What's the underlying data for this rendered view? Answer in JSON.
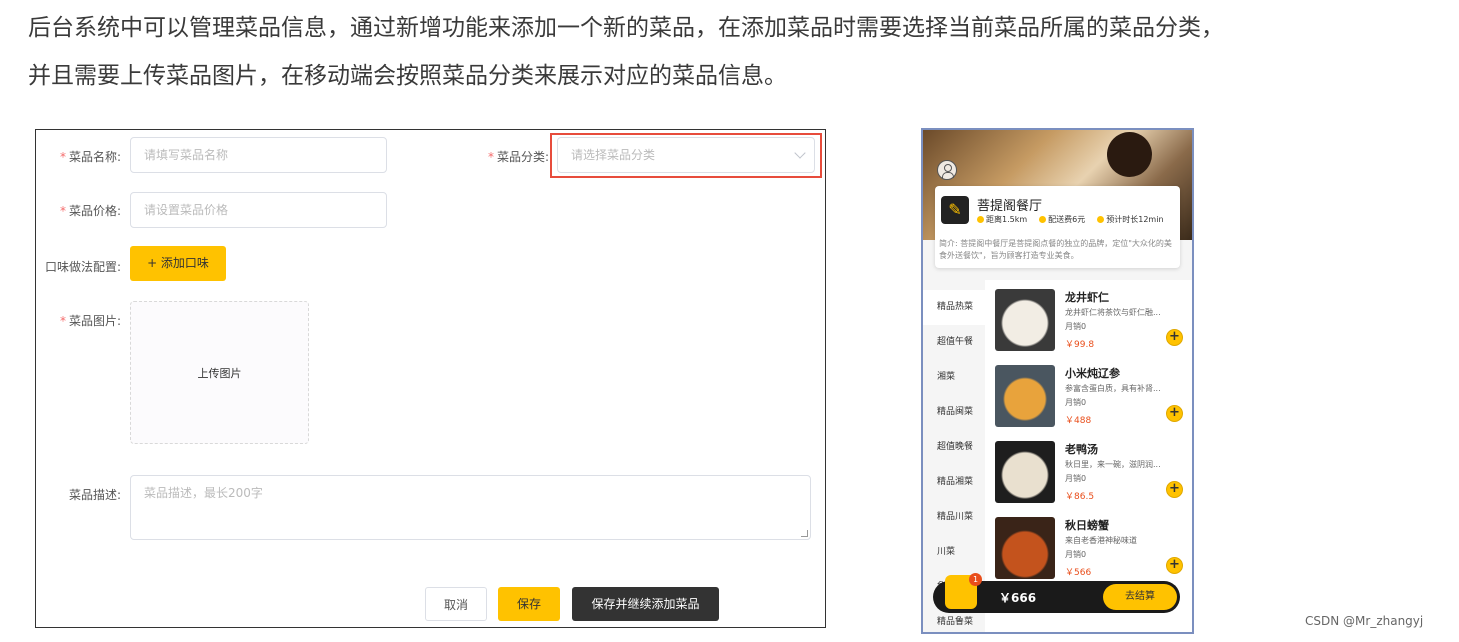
{
  "intro": {
    "line1": "后台系统中可以管理菜品信息，通过新增功能来添加一个新的菜品，在添加菜品时需要选择当前菜品所属的菜品分类，",
    "line2": "并且需要上传菜品图片，在移动端会按照菜品分类来展示对应的菜品信息。"
  },
  "form": {
    "required_mark": "*",
    "name_label": "菜品名称:",
    "name_placeholder": "请填写菜品名称",
    "category_label": "菜品分类:",
    "category_placeholder": "请选择菜品分类",
    "price_label": "菜品价格:",
    "price_placeholder": "请设置菜品价格",
    "flavor_label": "口味做法配置:",
    "add_flavor_button": "+ 添加口味",
    "image_label": "菜品图片:",
    "upload_text": "上传图片",
    "desc_label": "菜品描述:",
    "desc_placeholder": "菜品描述，最长200字",
    "cancel_button": "取消",
    "save_button": "保存",
    "save_continue_button": "保存并继续添加菜品",
    "accent_color": "#ffc200",
    "highlight_color": "#e74c3c"
  },
  "mobile": {
    "shop_name": "菩提阁餐厅",
    "distance": "距离1.5km",
    "delivery_fee": "配送费6元",
    "eta": "预计时长12min",
    "shop_intro": "简介: 菩提阁中餐厅是菩提阁点餐的独立的品牌，定位\"大众化的美食外送餐饮\"，旨为顾客打造专业美食。",
    "categories": [
      "精品热菜",
      "超值午餐",
      "湘菜",
      "精品闽菜",
      "超值晚餐",
      "精品湘菜",
      "精品川菜",
      "川菜",
      "鲁菜",
      "精品鲁菜"
    ],
    "dishes": [
      {
        "name": "龙井虾仁",
        "desc": "龙井虾仁将茶饮与虾仁融...",
        "sales": "月销0",
        "price": "￥99.8"
      },
      {
        "name": "小米炖辽参",
        "desc": "参富含蛋白质，具有补肾...",
        "sales": "月销0",
        "price": "￥488"
      },
      {
        "name": "老鸭汤",
        "desc": "秋日里，来一碗，滋阴润...",
        "sales": "月销0",
        "price": "￥86.5"
      },
      {
        "name": "秋日螃蟹",
        "desc": "来自老香港神秘味道",
        "sales": "月销0",
        "price": "￥566"
      }
    ],
    "add_symbol": "+",
    "cart_count": "1",
    "cart_total": "￥666",
    "checkout": "去结算"
  },
  "watermark": "CSDN @Mr_zhangyj"
}
